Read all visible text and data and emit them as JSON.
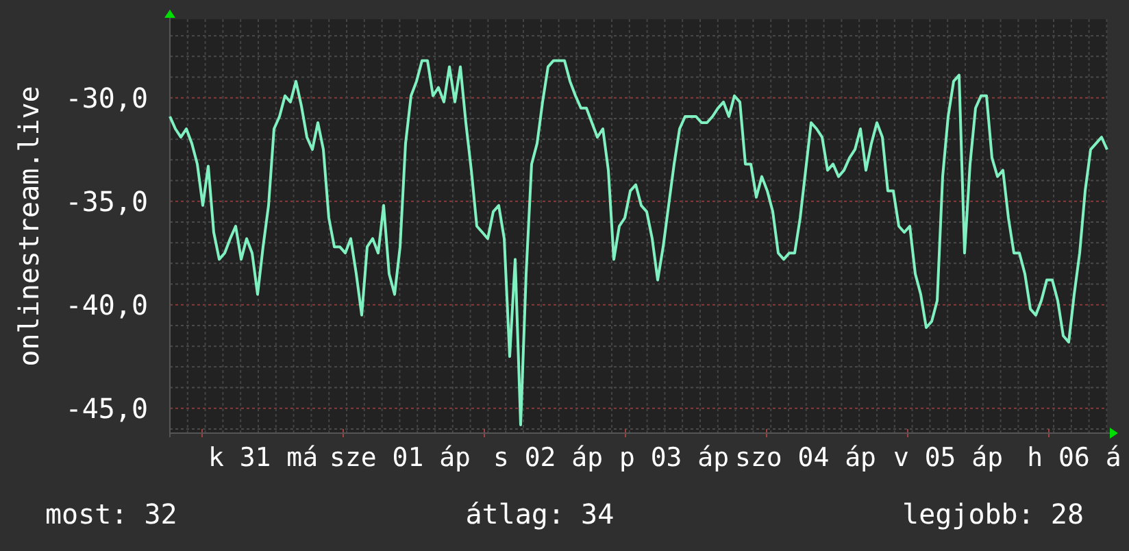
{
  "chart": {
    "chart_data": {
      "type": "line",
      "ylabel": "onlinestream.live",
      "categories": [
        null,
        null,
        null,
        null,
        null,
        null,
        null,
        null,
        null,
        null,
        null,
        null,
        null,
        null,
        null,
        null,
        null,
        "k 31 má",
        null,
        null,
        null,
        null,
        null,
        null,
        null,
        null,
        null,
        null,
        null,
        null,
        null,
        null,
        null,
        null,
        null,
        null,
        null,
        null,
        null,
        null,
        null,
        null,
        "sze 01 áp",
        null,
        null,
        null,
        null,
        null,
        null,
        null,
        null,
        null,
        null,
        null,
        null,
        null,
        null,
        null,
        null,
        null,
        null,
        null,
        null,
        null,
        null,
        null,
        null,
        null,
        null,
        "s 02 áp",
        null,
        null,
        null,
        null,
        null,
        null,
        null,
        null,
        null,
        null,
        null,
        null,
        null,
        null,
        null,
        null,
        null,
        null,
        null,
        null,
        null,
        null,
        "p 03 áp",
        null,
        null,
        null,
        null,
        null,
        null,
        null,
        null,
        null,
        null,
        null,
        null,
        null,
        null,
        null,
        null,
        null,
        null,
        null,
        null,
        null,
        null,
        null,
        "szo 04 áp",
        null,
        null,
        null,
        null,
        null,
        null,
        null,
        null,
        null,
        null,
        null,
        null,
        null,
        null,
        null,
        null,
        null,
        null,
        null,
        null,
        null,
        null,
        null,
        null,
        null,
        "v 05 áp",
        null,
        null,
        null,
        null,
        null,
        null,
        null,
        null,
        null,
        null,
        null,
        null,
        null,
        null,
        null,
        null,
        null,
        null,
        null,
        null,
        null,
        null,
        "h 06 á",
        null,
        null,
        null,
        null,
        null,
        null
      ],
      "grid": true,
      "series": [
        {
          "color": "#80f0c0",
          "values": [
            -30.9,
            -31.5,
            -31.9,
            -31.5,
            -32.2,
            -33.2,
            -35.2,
            -33.3,
            -36.5,
            -37.8,
            -37.5,
            -36.8,
            -36.2,
            -37.8,
            -36.8,
            -37.5,
            -39.5,
            -37.2,
            -35.2,
            -31.5,
            -30.9,
            -29.9,
            -30.2,
            -29.2,
            -30.4,
            -31.9,
            -32.5,
            -31.2,
            -32.5,
            -35.8,
            -37.2,
            -37.2,
            -37.5,
            -36.8,
            -38.5,
            -40.5,
            -37.2,
            -36.8,
            -37.5,
            -35.2,
            -38.5,
            -39.5,
            -37.2,
            -32.2,
            -29.9,
            -29.2,
            -28.2,
            -28.2,
            -29.9,
            -29.5,
            -30.2,
            -28.5,
            -30.2,
            -28.5,
            -31.2,
            -33.5,
            -36.2,
            -36.5,
            -36.8,
            -35.5,
            -35.2,
            -36.8,
            -42.5,
            -37.8,
            -45.8,
            -38.5,
            -33.2,
            -32.2,
            -30.2,
            -28.5,
            -28.2,
            -28.2,
            -28.2,
            -29.2,
            -29.9,
            -30.5,
            -30.5,
            -31.2,
            -31.9,
            -31.5,
            -33.5,
            -37.8,
            -36.2,
            -35.8,
            -34.5,
            -34.2,
            -35.2,
            -35.5,
            -36.8,
            -38.8,
            -37.2,
            -35.2,
            -33.2,
            -31.5,
            -30.9,
            -30.9,
            -30.9,
            -31.2,
            -31.2,
            -30.9,
            -30.5,
            -30.2,
            -30.9,
            -29.9,
            -30.2,
            -33.2,
            -33.2,
            -34.8,
            -33.8,
            -34.5,
            -35.5,
            -37.5,
            -37.8,
            -37.5,
            -37.5,
            -35.8,
            -33.5,
            -31.2,
            -31.5,
            -31.9,
            -33.5,
            -33.2,
            -33.8,
            -33.5,
            -32.9,
            -32.5,
            -31.5,
            -33.5,
            -32.2,
            -31.2,
            -31.9,
            -34.5,
            -34.5,
            -36.2,
            -36.5,
            -36.2,
            -38.5,
            -39.5,
            -41.1,
            -40.8,
            -39.8,
            -33.8,
            -30.9,
            -29.2,
            -28.9,
            -37.5,
            -33.2,
            -30.5,
            -29.9,
            -29.9,
            -32.9,
            -33.8,
            -33.5,
            -35.8,
            -37.5,
            -37.5,
            -38.5,
            -40.2,
            -40.5,
            -39.8,
            -38.8,
            -38.8,
            -39.8,
            -41.5,
            -41.8,
            -39.5,
            -37.5,
            -34.5,
            -32.5,
            -32.2,
            -31.9,
            -32.5
          ]
        }
      ],
      "ylim": [
        -46.2,
        -26.2
      ],
      "yticks": [
        {
          "value": -30,
          "label": "-30,0"
        },
        {
          "value": -35,
          "label": "-35,0"
        },
        {
          "value": -40,
          "label": "-40,0"
        },
        {
          "value": -45,
          "label": "-45,0"
        }
      ]
    }
  },
  "stats": [
    "most: 32",
    "átlag: 34",
    "legjobb: 28"
  ]
}
